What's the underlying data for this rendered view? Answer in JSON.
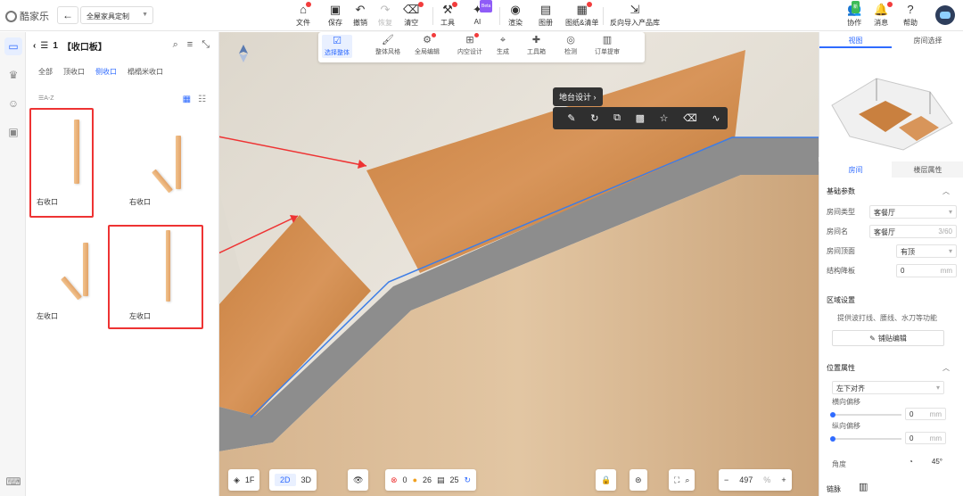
{
  "app": {
    "logo_text": "酷家乐",
    "project": "全屋家具定制"
  },
  "toolbar": {
    "file": "文件",
    "save": "保存",
    "undo": "撤销",
    "redo": "恢复",
    "clear": "清空",
    "tools": "工具",
    "ai": "AI",
    "ai_badge": "Beta",
    "render": "渲染",
    "gallery": "图册",
    "drawings": "图纸&清单",
    "import": "反向导入产品库",
    "collab": "协作",
    "collab_badge": "新",
    "messages": "消息",
    "help": "帮助"
  },
  "catalog": {
    "count": "1",
    "title": "【收口板】",
    "tabs": [
      "全部",
      "顶收口",
      "侧收口",
      "榻榻米收口"
    ],
    "active_tab": "侧收口",
    "sort": "A-Z",
    "items": [
      {
        "label": "右收口",
        "highlighted": true
      },
      {
        "label": "右收口",
        "highlighted": false
      },
      {
        "label": "左收口",
        "highlighted": false
      },
      {
        "label": "左收口",
        "highlighted": true
      }
    ]
  },
  "floatbar": [
    "选择整体",
    "整体风格",
    "全局编辑",
    "内空设计",
    "生成",
    "工具箱",
    "检测",
    "订单提审"
  ],
  "context": {
    "label": "地台设计"
  },
  "bottom": {
    "floor": "1F",
    "mode2d": "2D",
    "mode3d": "3D",
    "errors": "0",
    "warnings": "26",
    "items": "25",
    "zoom": "497",
    "zoom_unit": "%"
  },
  "preview": {
    "tabs": [
      "视图",
      "房间选择"
    ],
    "active": "视图"
  },
  "props": {
    "tabs": [
      "房间",
      "楼层属性"
    ],
    "active": "房间",
    "basic_title": "基础参数",
    "room_type_label": "房间类型",
    "room_type": "客餐厅",
    "room_name_label": "房间名",
    "room_name": "客餐厅",
    "room_name_count": "3/60",
    "ceiling_label": "房间顶面",
    "ceiling": "有顶",
    "drop_label": "结构降板",
    "drop": "0",
    "drop_unit": "mm",
    "zone_title": "区域设置",
    "zone_desc": "提供波打线、腰线、水刀等功能",
    "pave_btn": "铺贴编辑",
    "pos_title": "位置属性",
    "align": "左下对齐",
    "h_offset_label": "横向偏移",
    "h_offset": "0",
    "v_offset_label": "纵向偏移",
    "v_offset": "0",
    "unit": "mm",
    "angle_label": "角度",
    "angle": "45",
    "angle_unit": "°",
    "footer": "链脉"
  }
}
